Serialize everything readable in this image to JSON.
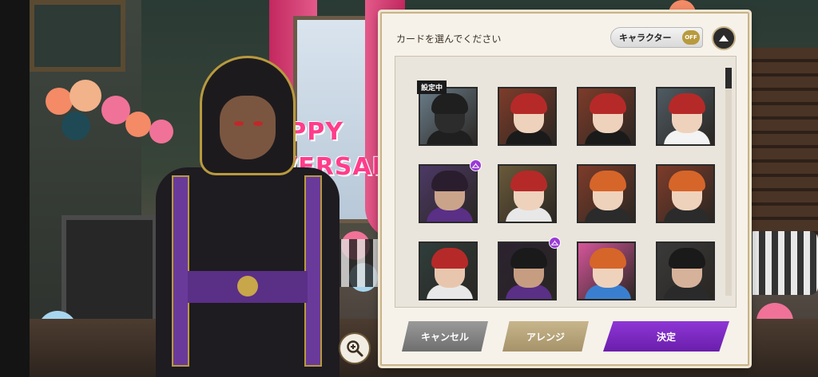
{
  "dialog": {
    "title": "カードを選んでください",
    "character_toggle": {
      "label": "キャラクター",
      "state": "OFF"
    },
    "collapse_icon": "chevron-up-icon"
  },
  "cards": [
    {
      "badge": "設定中",
      "bg": "#6a7d8a",
      "hair": "#1f1f1f",
      "skin": "#2c2c2c",
      "outfit": "#1f1f1f"
    },
    {
      "bg": "#7e3c2a",
      "hair": "#b52a28",
      "skin": "#efd2bc",
      "outfit": "#1a1a1a"
    },
    {
      "bg": "#7e3c2a",
      "hair": "#b52a28",
      "skin": "#efd2bc",
      "outfit": "#1a1a1a"
    },
    {
      "bg": "#4f5b63",
      "hair": "#b52a28",
      "skin": "#efd2bc",
      "outfit": "#f3f3f3"
    },
    {
      "outfit_badge": true,
      "bg": "#4c3966",
      "hair": "#2a1e2e",
      "skin": "#caa48a",
      "outfit": "#5a2f86"
    },
    {
      "bg": "#6a5a3a",
      "hair": "#b52a28",
      "skin": "#efd2bc",
      "outfit": "#e8e8e8"
    },
    {
      "bg": "#7e3c2a",
      "hair": "#d6652a",
      "skin": "#efd2bc",
      "outfit": "#2b2b2b"
    },
    {
      "bg": "#7e3c2a",
      "hair": "#d6652a",
      "skin": "#efd2bc",
      "outfit": "#2b2b2b"
    },
    {
      "bg": "#2f3e3b",
      "hair": "#b52a28",
      "skin": "#e8c6ad",
      "outfit": "#e8e8e8"
    },
    {
      "outfit_badge": true,
      "bg": "#2b2230",
      "hair": "#1a1a1a",
      "skin": "#c79d82",
      "outfit": "#5a2f86"
    },
    {
      "bg": "#d6569a",
      "hair": "#d6652a",
      "skin": "#efd2bc",
      "outfit": "#3a7fcf"
    },
    {
      "bg": "#3a3a3a",
      "hair": "#1a1a1a",
      "skin": "#d7b29a",
      "outfit": "#2a2a2a"
    }
  ],
  "buttons": {
    "cancel": "キャンセル",
    "arrange": "アレンジ",
    "confirm": "決定"
  },
  "background": {
    "banner_line1": "APPY",
    "banner_line2": "VERSARY"
  },
  "zoom_icon": "zoom-in-icon",
  "colors": {
    "accent": "#7b2bc2",
    "gold": "#b89a3e",
    "panel": "#f6f2ea"
  }
}
